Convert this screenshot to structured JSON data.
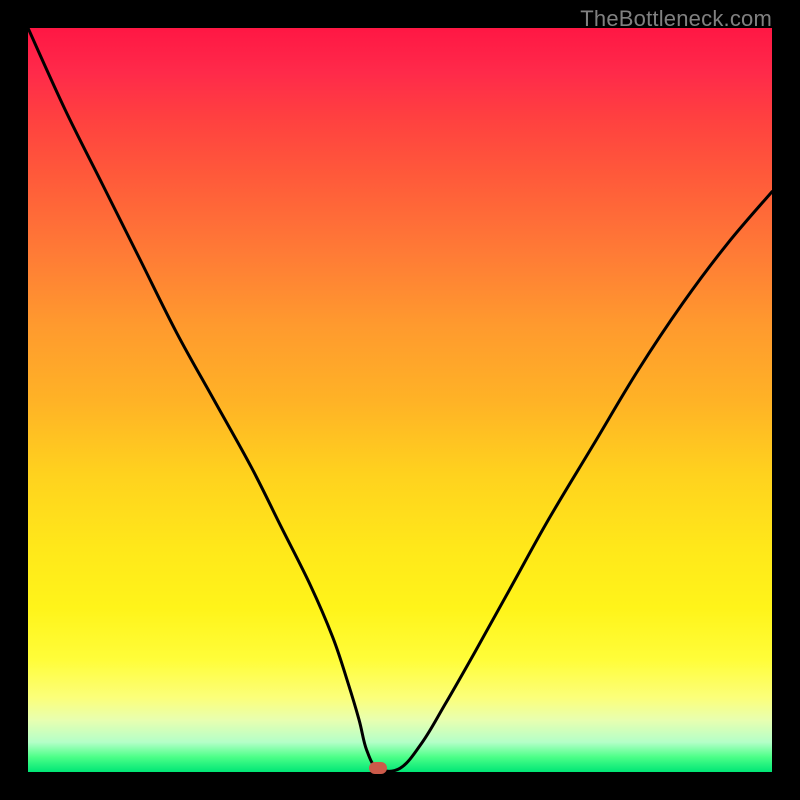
{
  "watermark": "TheBottleneck.com",
  "chart_data": {
    "type": "line",
    "title": "",
    "xlabel": "",
    "ylabel": "",
    "xlim": [
      0,
      1
    ],
    "ylim": [
      0,
      1
    ],
    "series": [
      {
        "name": "curve",
        "x": [
          0.0,
          0.05,
          0.1,
          0.15,
          0.2,
          0.25,
          0.3,
          0.34,
          0.38,
          0.41,
          0.43,
          0.445,
          0.455,
          0.47,
          0.5,
          0.53,
          0.56,
          0.6,
          0.65,
          0.7,
          0.76,
          0.82,
          0.88,
          0.94,
          1.0
        ],
        "y": [
          1.0,
          0.89,
          0.79,
          0.69,
          0.59,
          0.5,
          0.41,
          0.33,
          0.25,
          0.18,
          0.12,
          0.07,
          0.03,
          0.005,
          0.005,
          0.04,
          0.09,
          0.16,
          0.25,
          0.34,
          0.44,
          0.54,
          0.63,
          0.71,
          0.78
        ]
      }
    ],
    "marker": {
      "x": 0.47,
      "y": 0.0
    },
    "gradient_stops": [
      {
        "pos": 0.0,
        "color": "#ff1744"
      },
      {
        "pos": 0.5,
        "color": "#ffb226"
      },
      {
        "pos": 0.85,
        "color": "#fffd3a"
      },
      {
        "pos": 1.0,
        "color": "#00e676"
      }
    ]
  }
}
